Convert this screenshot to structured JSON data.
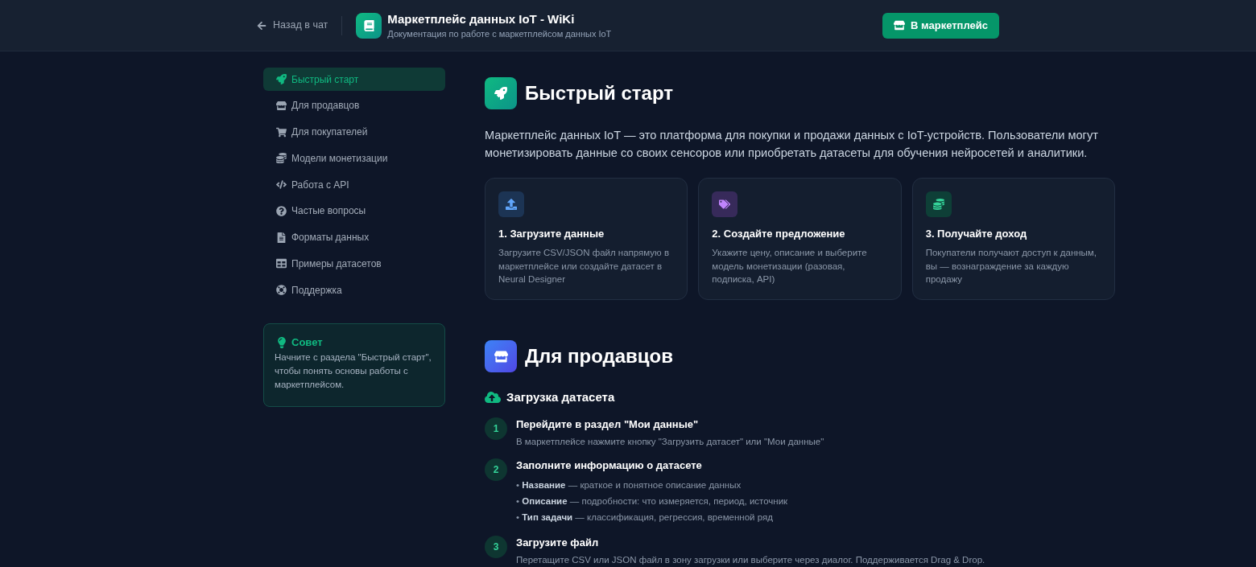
{
  "header": {
    "back_link": "Назад в чат",
    "title": "Маркетплейс данных IoT - WiKi",
    "subtitle": "Документация по работе с маркетплейсом данных IoT",
    "button": "В маркетплейс"
  },
  "sidebar": {
    "items": [
      {
        "label": "Быстрый старт",
        "selected": true
      },
      {
        "label": "Для продавцов",
        "selected": false
      },
      {
        "label": "Для покупателей",
        "selected": false
      },
      {
        "label": "Модели монетизации",
        "selected": false
      },
      {
        "label": "Работа с API",
        "selected": false
      },
      {
        "label": "Частые вопросы",
        "selected": false
      },
      {
        "label": "Форматы данных",
        "selected": false
      },
      {
        "label": "Примеры датасетов",
        "selected": false
      },
      {
        "label": "Поддержка",
        "selected": false
      }
    ],
    "tip": {
      "title": "Совет",
      "text": "Начните с раздела \"Быстрый старт\", чтобы понять основы работы с маркетплейсом."
    }
  },
  "quick_start": {
    "title": "Быстрый старт",
    "intro": "Маркетплейс данных IoT — это платформа для покупки и продажи данных с IoT-устройств. Пользователи могут монетизировать данные со своих сенсоров или приобретать датасеты для обучения нейросетей и аналитики.",
    "cards": [
      {
        "title": "1. Загрузите данные",
        "text": "Загрузите CSV/JSON файл напрямую в маркетплейсе или создайте датасет в Neural Designer"
      },
      {
        "title": "2. Создайте предложение",
        "text": "Укажите цену, описание и выберите модель монетизации (разовая, подписка, API)"
      },
      {
        "title": "3. Получайте доход",
        "text": "Покупатели получают доступ к данным, вы — вознаграждение за каждую продажу"
      }
    ]
  },
  "sellers": {
    "title": "Для продавцов",
    "upload": {
      "title": "Загрузка датасета",
      "steps": [
        {
          "number": "1",
          "title": "Перейдите в раздел \"Мои данные\"",
          "text": "В маркетплейсе нажмите кнопку \"Загрузить датасет\" или \"Мои данные\""
        },
        {
          "number": "2",
          "title": "Заполните информацию о датасете",
          "bullets": [
            "• **Название** — краткое и понятное описание данных",
            "• **Описание** — подробности: что измеряется, период, источник",
            "• **Тип задачи** — классификация, регрессия, временной ряд"
          ]
        },
        {
          "number": "3",
          "title": "Загрузите файл",
          "text": "Перетащите CSV или JSON файл в зону загрузки или выберите через диалог. Поддерживается Drag & Drop."
        }
      ]
    }
  }
}
